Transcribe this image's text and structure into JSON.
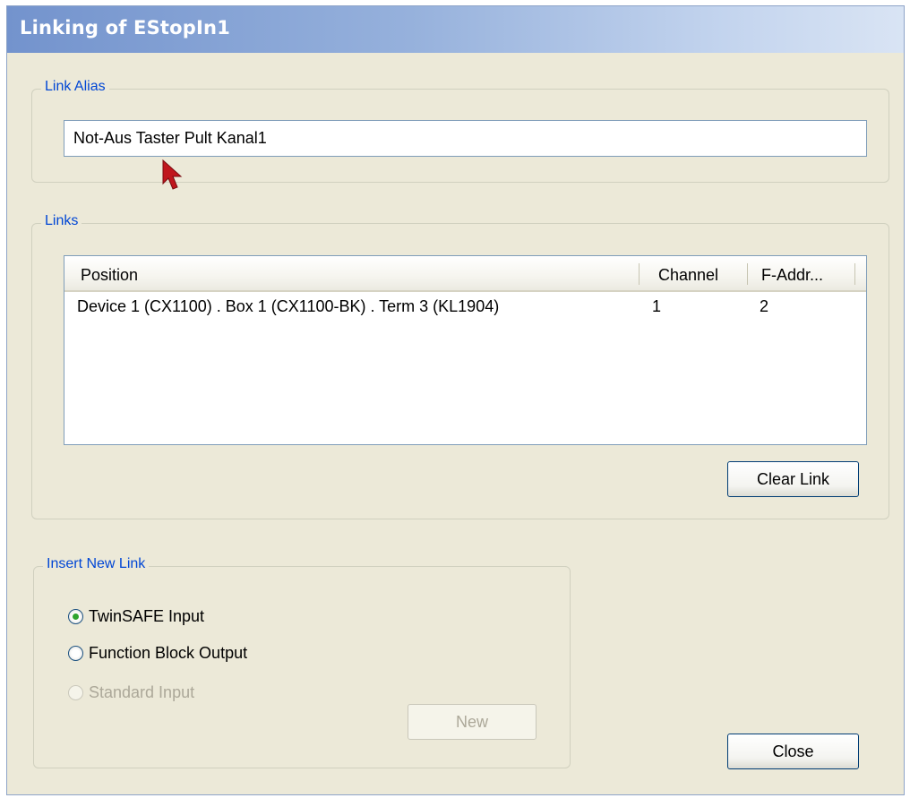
{
  "window": {
    "title": "Linking of EStopIn1"
  },
  "link_alias": {
    "label": "Link Alias",
    "value": "Not-Aus Taster Pult Kanal1"
  },
  "links": {
    "label": "Links",
    "columns": [
      "Position",
      "Channel",
      "F-Addr..."
    ],
    "rows": [
      {
        "position": "Device 1 (CX1100) . Box 1 (CX1100-BK) . Term 3 (KL1904)",
        "channel": "1",
        "f_addr": "2"
      }
    ],
    "clear_link_label": "Clear Link"
  },
  "insert_new_link": {
    "label": "Insert New Link",
    "options": [
      {
        "label": "TwinSAFE Input",
        "checked": true,
        "enabled": true
      },
      {
        "label": "Function Block Output",
        "checked": false,
        "enabled": true
      },
      {
        "label": "Standard Input",
        "checked": false,
        "enabled": false
      }
    ],
    "new_label": "New"
  },
  "close_label": "Close",
  "colors": {
    "group_label": "#0046d5",
    "dialog_bg": "#ece9d8",
    "radio_dot": "#2fa52f",
    "cursor": "#c0161d"
  }
}
